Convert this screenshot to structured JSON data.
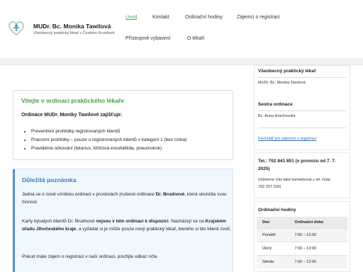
{
  "brand": {
    "name": "MUDr. Bc. Monika Tawilová",
    "subtitle": "Všeobecný praktický lékař v Českém Krumlově"
  },
  "nav": {
    "items": [
      "Úvod",
      "Kontakt",
      "Ordinační hodiny",
      "Zájemci o registraci",
      "Přístrojové vybavení",
      "O lékaři"
    ],
    "active": "Úvod"
  },
  "welcome": {
    "title": "Vítejte v ordinaci praktického lékaře",
    "lead": "Ordinace MUDr. Moniky Tawilové zajišťuje:",
    "items": [
      "Preventivní prohlídky registrovaných klientů",
      "Pracovní prohlídky – pouze u registrovaných klientů v kategorii 1 (bez rizika)",
      "Pravidelná očkování (tetanus, klíšťová encefalitida, pneumokok)"
    ]
  },
  "notice": {
    "title": "Důležitá poznámka",
    "p1_a": "Jedná se o nově vzniklou ordinaci v prostorách zrušené ordinace ",
    "p1_b": "Dr. Brudnové",
    "p1_c": ", která ukončila svou činnost.",
    "p2_a": "Karty bývalých klientů Dr. Brudnové ",
    "p2_b": "nejsou v této ordinaci k dispozici",
    "p2_c": ". Nacházejí se na ",
    "p2_d": "Krajském úřadu Jihočeského kraje",
    "p2_e": ", a vyžádat si je může pouze nový praktický lékař, kterého si tito klienti zvolí.",
    "p3": "Pokud máte zájem o registraci v naší ordinaci, použijte odkaz níže."
  },
  "sidebar": {
    "doctor_heading": "Všeobecný praktický lékař",
    "doctor_name": "MUDr. Bc. Monika Tawilová",
    "nurse_heading": "Sestra ordinace",
    "nurse_name": "Bc. Anna Hrachovská",
    "form_link": "Formulář pro zájemce o registraci",
    "phone_line1": "Tel.: 702 841 851 (v provozu od 7. 7.",
    "phone_line2": "2025)",
    "phone_note1": "(můžeme Vás také kontaktovat z tel. čísla:",
    "phone_note2": "792 207 200)",
    "hours_heading": "Ordinační hodiny",
    "hours_headers": [
      "Den",
      "Ordinační doba"
    ],
    "hours_rows": [
      [
        "Pondělí",
        "7:00 – 13:00"
      ],
      [
        "Úterý",
        "7:00 – 13:00"
      ],
      [
        "Středa",
        "7:00 – 13:00"
      ]
    ]
  },
  "colors": {
    "accent_green": "#4caf50",
    "link_blue": "#2a6ebb",
    "notice_border": "#4a90d9"
  }
}
